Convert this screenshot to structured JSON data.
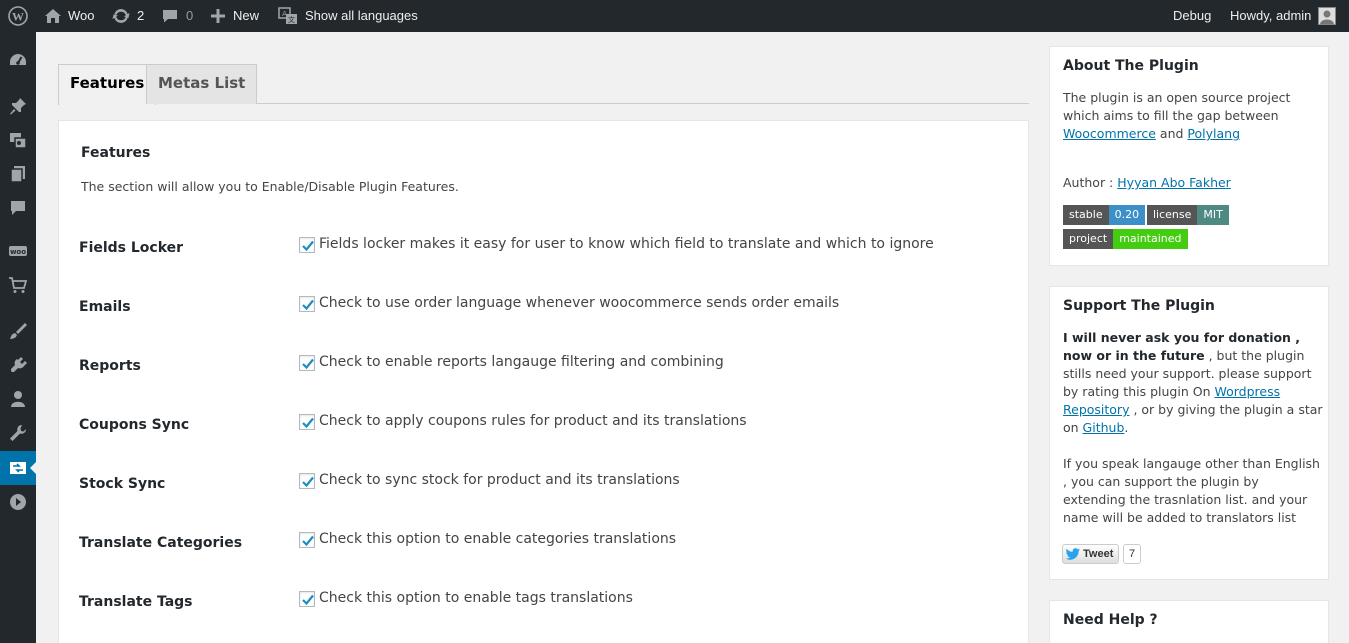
{
  "adminbar": {
    "site_name": "Woo",
    "updates_count": "2",
    "comments_count": "0",
    "new_label": "New",
    "languages_label": "Show all languages",
    "debug_label": "Debug",
    "howdy_label": "Howdy, admin"
  },
  "menu": {
    "icons": [
      "dashboard-icon",
      "posts-icon",
      "media-icon",
      "pages-icon",
      "comments-icon",
      "woocommerce-icon",
      "products-icon",
      "appearance-icon",
      "plugins-icon",
      "users-icon",
      "tools-icon",
      "hyyan-plugin-icon",
      "collapse-icon"
    ],
    "current_color": "#0073aa"
  },
  "tabs": [
    {
      "label": "Features",
      "active": true
    },
    {
      "label": "Metas List",
      "active": false
    }
  ],
  "features": {
    "title": "Features",
    "description": "The section will allow you to Enable/Disable Plugin Features.",
    "rows": [
      {
        "label": "Fields Locker",
        "text": "Fields locker makes it easy for user to know which field to translate and which to ignore",
        "checked": true
      },
      {
        "label": "Emails",
        "text": "Check to use order language whenever woocommerce sends order emails",
        "checked": true
      },
      {
        "label": "Reports",
        "text": "Check to enable reports langauge filtering and combining",
        "checked": true
      },
      {
        "label": "Coupons Sync",
        "text": "Check to apply coupons rules for product and its translations",
        "checked": true
      },
      {
        "label": "Stock Sync",
        "text": "Check to sync stock for product and its translations",
        "checked": true
      },
      {
        "label": "Translate Categories",
        "text": "Check this option to enable categories translations",
        "checked": true
      },
      {
        "label": "Translate Tags",
        "text": "Check this option to enable tags translations",
        "checked": true
      }
    ]
  },
  "about": {
    "title": "About The Plugin",
    "text_1": "The plugin is an open source project which aims to fill the gap between",
    "link_woocommerce": "Woocommerce",
    "and": "and",
    "link_polylang": "Polylang",
    "author_label": "Author :",
    "author_name": "Hyyan Abo Fakher",
    "badges": [
      {
        "left": "stable",
        "right": "0.20",
        "right_color": "#3c8fc7"
      },
      {
        "left": "license",
        "right": "MIT",
        "right_color": "#4e8a82"
      },
      {
        "left": "project",
        "right": "maintained",
        "right_color": "#44cc11"
      }
    ]
  },
  "support": {
    "title": "Support The Plugin",
    "bold_text": "I will never ask you for donation , now or in the future",
    "text_1": " , but the plugin stills need your support. please support by rating this plugin On ",
    "link_wordpress": "Wordpress Repository",
    "text_2": " , or by giving the plugin a star on ",
    "link_github": "Github",
    "text_3": ".",
    "text_4": "If you speak langauge other than English , you can support the plugin by extending the trasnlation list. and your name will be added to translators list",
    "tweet_label": "Tweet",
    "tweet_count": "7"
  },
  "help": {
    "title": "Need Help ?"
  }
}
